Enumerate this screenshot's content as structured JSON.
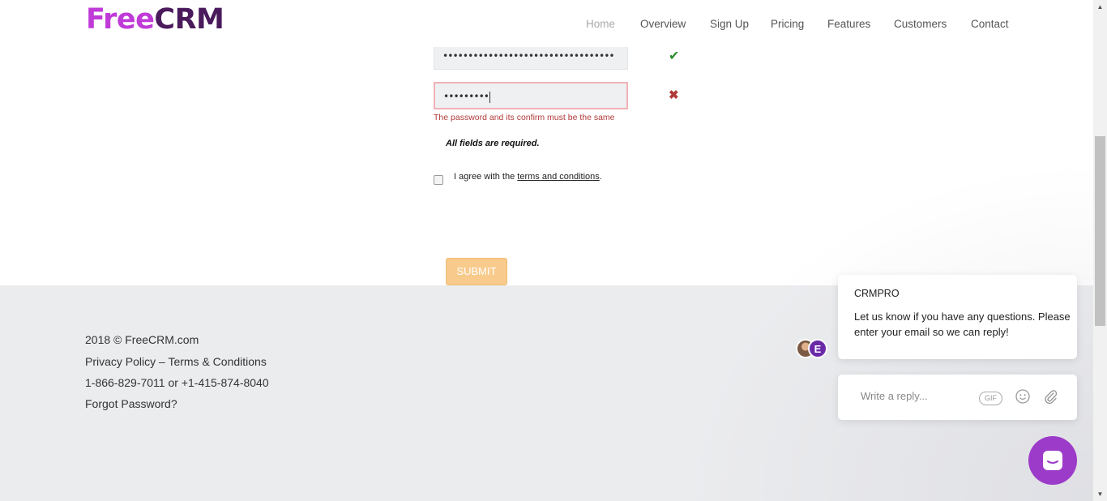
{
  "brand": {
    "part1": "Free",
    "part2": "CRM"
  },
  "nav": {
    "home": "Home",
    "overview": "Overview",
    "signup": "Sign Up",
    "pricing": "Pricing",
    "features": "Features",
    "customers": "Customers",
    "contact": "Contact"
  },
  "form": {
    "password_value": "••••••••••••••••••••••••••••••••••",
    "confirm_value": "•••••••••",
    "error_message": "The password and its confirm must be the same",
    "required_note": "All fields are required.",
    "agree_prefix": "I agree with the",
    "terms_link": "terms and conditions",
    "agree_suffix": ".",
    "submit_label": "SUBMIT"
  },
  "footer": {
    "copyright": "2018 © FreeCRM.com",
    "policy": "Privacy Policy – Terms & Conditions",
    "phones": "1-866-829-7011 or +1-415-874-8040",
    "forgot": "Forgot Password?"
  },
  "chat": {
    "sender": "CRMPRO",
    "message": "Let us know if you have any questions. Please enter your email so we can reply!",
    "avatar_letter": "E",
    "reply_placeholder": "Write a reply...",
    "gif_label": "GIF"
  },
  "colors": {
    "brand_pink": "#c03ad8",
    "brand_dark": "#4a1a5c",
    "error": "#b03a3a",
    "success": "#2e8b2e",
    "submit": "#f8cb8c",
    "launcher": "#9c3bc9"
  }
}
